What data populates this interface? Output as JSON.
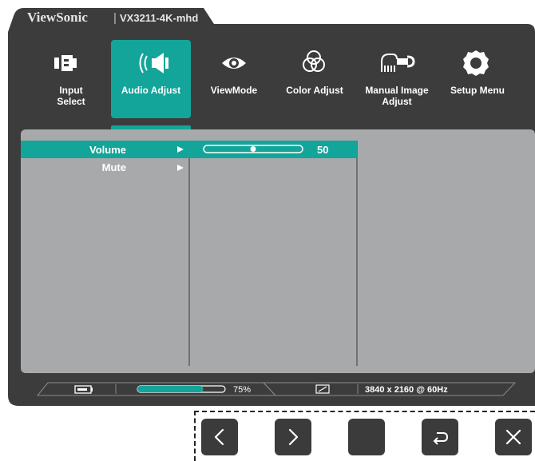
{
  "brand": {
    "name": "ViewSonic",
    "model": "VX3211-4K-mhd"
  },
  "menu": [
    {
      "label_1": "Input",
      "label_2": "Select",
      "icon": "input-select-icon",
      "active": false
    },
    {
      "label_1": "Audio Adjust",
      "label_2": "",
      "icon": "speaker-icon",
      "active": true
    },
    {
      "label_1": "ViewMode",
      "label_2": "",
      "icon": "eye-icon",
      "active": false
    },
    {
      "label_1": "Color Adjust",
      "label_2": "",
      "icon": "color-circles-icon",
      "active": false
    },
    {
      "label_1": "Manual Image",
      "label_2": "Adjust",
      "icon": "wrench-hand-icon",
      "active": false
    },
    {
      "label_1": "Setup Menu",
      "label_2": "",
      "icon": "gear-icon",
      "active": false
    }
  ],
  "submenu": [
    {
      "label": "Volume",
      "selected": true
    },
    {
      "label": "Mute",
      "selected": false
    }
  ],
  "volume": {
    "value": "50",
    "fraction": 0.5
  },
  "status": {
    "progress_text": "75%",
    "progress_fraction": 0.75,
    "resolution": "3840 x 2160 @ 60Hz"
  },
  "colors": {
    "accent": "#13a59a",
    "panel": "#a8a9ab",
    "frame": "#3c3c3c",
    "text_light": "#ffffff"
  },
  "buttons": [
    "left-arrow-icon",
    "right-arrow-icon",
    "blank-key",
    "return-icon",
    "close-icon"
  ]
}
